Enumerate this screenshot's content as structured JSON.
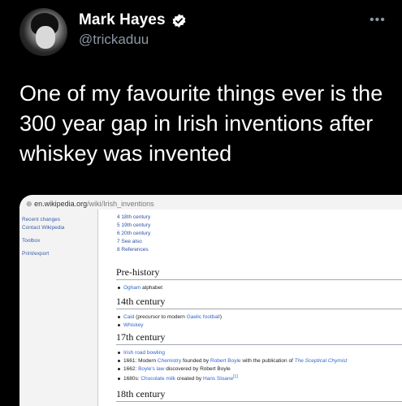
{
  "tweet": {
    "name": "Mark Hayes",
    "handle": "@trickaduu",
    "more_icon": "more-horizontal-icon",
    "text": "One of my favourite things ever is the 300 year gap in Irish inventions after whiskey was invented"
  },
  "wiki": {
    "url_domain": "en.wikipedia.org",
    "url_path": "/wiki/Irish_inventions",
    "sidebar": [
      "Recent changes",
      "Contact Wikipedia",
      "Toolbox",
      "Print/export"
    ],
    "toc": [
      "4 18th century",
      "5 19th century",
      "6 20th century",
      "7 See also",
      "8 References"
    ],
    "sections": {
      "prehistory": {
        "title": "Pre-history",
        "item1_link": "Ogham",
        "item1_text": " alphabet"
      },
      "c14": {
        "title": "14th century",
        "item1_link": "Caid",
        "item1_text_a": " (precursor to modern ",
        "item1_link2": "Gaelic football",
        "item1_text_b": ")",
        "item2_link": "Whiskey"
      },
      "c17": {
        "title": "17th century",
        "item1_link": "Irish road bowling",
        "item2_a": "1661: Modern ",
        "item2_link1": "Chemistry",
        "item2_b": " founded by ",
        "item2_link2": "Robert Boyle",
        "item2_c": " with the publication of ",
        "item2_link3": "The Sceptical Chymist",
        "item3_a": "1662: ",
        "item3_link": "Boyle's law",
        "item3_b": " discovered by Robert Boyle",
        "item4_a": "1680s: ",
        "item4_link1": "Chocolate milk",
        "item4_b": " created by ",
        "item4_link2": "Hans Sloane",
        "item4_ref": "[1]"
      },
      "c18": {
        "title": "18th century"
      }
    }
  },
  "colors": {
    "background": "#000000",
    "handle": "#8b98a5",
    "verified": "#ffffff",
    "wiki_link": "#3366cc"
  }
}
